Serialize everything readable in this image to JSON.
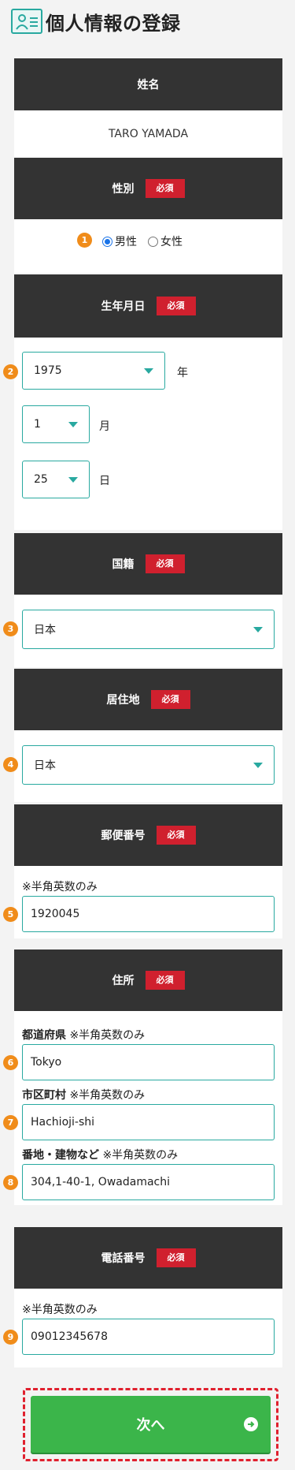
{
  "page_title": "個人情報の登録",
  "required_label": "必須",
  "name_section": {
    "title": "姓名",
    "value": "TARO YAMADA"
  },
  "gender_section": {
    "title": "性別",
    "step": "1",
    "options": [
      {
        "label": "男性",
        "selected": true
      },
      {
        "label": "女性",
        "selected": false
      }
    ]
  },
  "birth_section": {
    "title": "生年月日",
    "step": "2",
    "year": {
      "value": "1975",
      "unit": "年"
    },
    "month": {
      "value": "1",
      "unit": "月"
    },
    "day": {
      "value": "25",
      "unit": "日"
    }
  },
  "nationality_section": {
    "title": "国籍",
    "step": "3",
    "value": "日本"
  },
  "residence_section": {
    "title": "居住地",
    "step": "4",
    "value": "日本"
  },
  "postal_section": {
    "title": "郵便番号",
    "step": "5",
    "note": "※半角英数のみ",
    "value": "1920045"
  },
  "address_section": {
    "title": "住所",
    "note": "※半角英数のみ",
    "prefecture": {
      "label": "都道府県",
      "step": "6",
      "value": "Tokyo"
    },
    "city": {
      "label": "市区町村",
      "step": "7",
      "value": "Hachioji-shi"
    },
    "street": {
      "label": "番地・建物など",
      "step": "8",
      "value": "304,1-40-1, Owadamachi"
    }
  },
  "phone_section": {
    "title": "電話番号",
    "step": "9",
    "note": "※半角英数のみ",
    "value": "09012345678"
  },
  "next_button": {
    "label": "次へ"
  },
  "colors": {
    "header_bg": "#333333",
    "required_badge": "#d0202e",
    "input_border": "#29a9a0",
    "step_badge": "#f08c1a",
    "next_button": "#3bb54a",
    "highlight_border": "#e0202e"
  }
}
